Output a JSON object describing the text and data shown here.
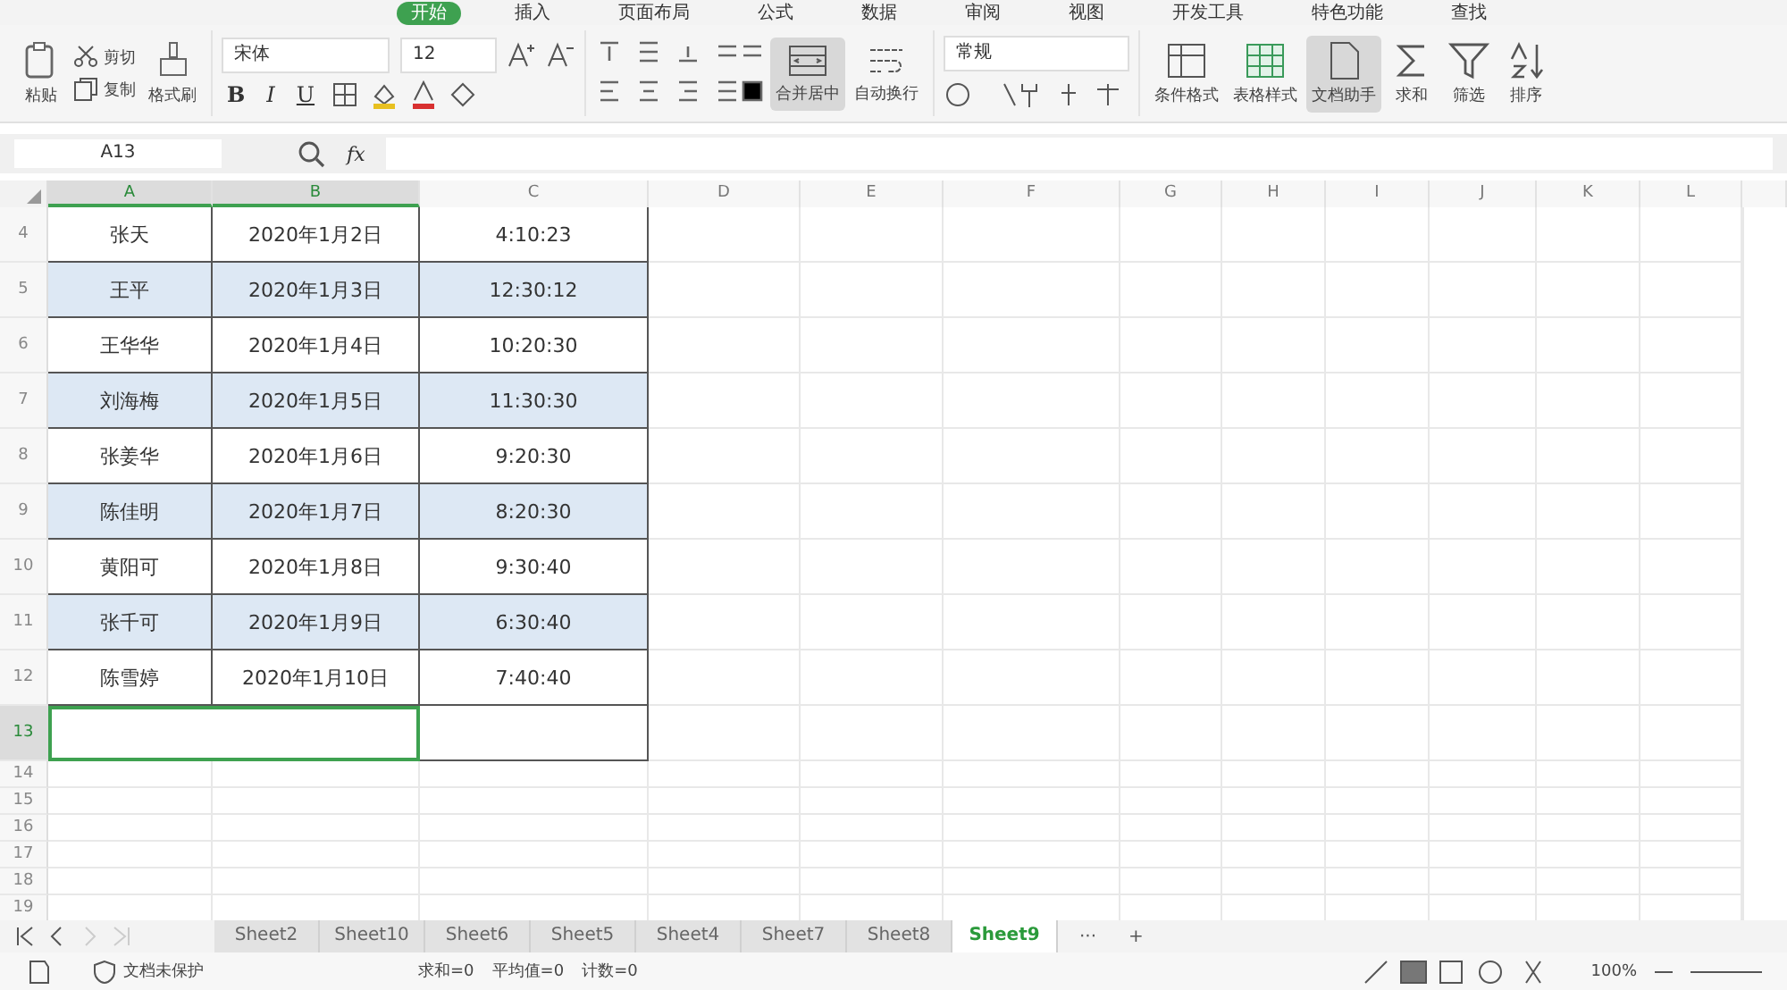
{
  "menu_tabs": [
    {
      "label": "开始",
      "selected": true
    },
    {
      "label": "插入",
      "selected": false
    },
    {
      "label": "页面布局",
      "selected": false
    },
    {
      "label": "公式",
      "selected": false
    },
    {
      "label": "数据",
      "selected": false
    },
    {
      "label": "审阅",
      "selected": false
    },
    {
      "label": "视图",
      "selected": false
    },
    {
      "label": "开发工具",
      "selected": false
    },
    {
      "label": "特色功能",
      "selected": false
    },
    {
      "label": "查找",
      "selected": false
    }
  ],
  "ribbon": {
    "paste": "粘贴",
    "cut": "剪切",
    "copy": "复制",
    "format_painter": "格式刷",
    "font": {
      "family": "宋体",
      "size": "12",
      "bold": "B",
      "italic": "I",
      "underline": "U"
    },
    "merge": {
      "label": "合并居中",
      "selected": true
    },
    "wrap": "自动换行",
    "number_format": "常规",
    "tools": [
      {
        "label": "条件格式",
        "kind": "table",
        "selected": false
      },
      {
        "label": "表格样式",
        "kind": "grid",
        "selected": false
      },
      {
        "label": "文档助手",
        "kind": "doc",
        "selected": true
      },
      {
        "label": "求和",
        "kind": "sum",
        "selected": false
      },
      {
        "label": "筛选",
        "kind": "filter",
        "selected": false
      },
      {
        "label": "排序",
        "kind": "sort",
        "selected": false
      }
    ]
  },
  "formula_bar": {
    "name_box": "A13",
    "fx": "fx"
  },
  "columns": [
    {
      "label": "A",
      "selected": true
    },
    {
      "label": "B",
      "selected": true
    },
    {
      "label": "C",
      "selected": false
    },
    {
      "label": "D",
      "selected": false
    },
    {
      "label": "E",
      "selected": false
    },
    {
      "label": "F",
      "selected": false
    },
    {
      "label": "G",
      "selected": false
    },
    {
      "label": "H",
      "selected": false
    },
    {
      "label": "I",
      "selected": false
    },
    {
      "label": "J",
      "selected": false
    },
    {
      "label": "K",
      "selected": false
    },
    {
      "label": "L",
      "selected": false
    }
  ],
  "rows": [
    {
      "number": "4",
      "banded": false,
      "selected": false,
      "cells": [
        "张天",
        "2020年1月2日",
        "4:10:23"
      ]
    },
    {
      "number": "5",
      "banded": true,
      "selected": false,
      "cells": [
        "王平",
        "2020年1月3日",
        "12:30:12"
      ]
    },
    {
      "number": "6",
      "banded": false,
      "selected": false,
      "cells": [
        "王华华",
        "2020年1月4日",
        "10:20:30"
      ]
    },
    {
      "number": "7",
      "banded": true,
      "selected": false,
      "cells": [
        "刘海梅",
        "2020年1月5日",
        "11:30:30"
      ]
    },
    {
      "number": "8",
      "banded": false,
      "selected": false,
      "cells": [
        "张姜华",
        "2020年1月6日",
        "9:20:30"
      ]
    },
    {
      "number": "9",
      "banded": true,
      "selected": false,
      "cells": [
        "陈佳明",
        "2020年1月7日",
        "8:20:30"
      ]
    },
    {
      "number": "10",
      "banded": false,
      "selected": false,
      "cells": [
        "黄阳可",
        "2020年1月8日",
        "9:30:40"
      ]
    },
    {
      "number": "11",
      "banded": true,
      "selected": false,
      "cells": [
        "张千可",
        "2020年1月9日",
        "6:30:40"
      ]
    },
    {
      "number": "12",
      "banded": false,
      "selected": false,
      "cells": [
        "陈雪婷",
        "2020年1月10日",
        "7:40:40"
      ]
    },
    {
      "number": "13",
      "selected": true,
      "cells": []
    }
  ],
  "empty_rows": [
    "14",
    "15",
    "16",
    "17",
    "18",
    "19"
  ],
  "sheet_tabs": [
    {
      "label": "Sheet2",
      "selected": false
    },
    {
      "label": "Sheet10",
      "selected": false
    },
    {
      "label": "Sheet6",
      "selected": false
    },
    {
      "label": "Sheet5",
      "selected": false
    },
    {
      "label": "Sheet4",
      "selected": false
    },
    {
      "label": "Sheet7",
      "selected": false
    },
    {
      "label": "Sheet8",
      "selected": false
    },
    {
      "label": "Sheet9",
      "selected": true
    }
  ],
  "sheet_more": "···",
  "sheet_add": "+",
  "status_bar": {
    "protection": "文档未保护",
    "stats": [
      "求和=0",
      "平均值=0",
      "计数=0"
    ],
    "zoom": "100%"
  }
}
